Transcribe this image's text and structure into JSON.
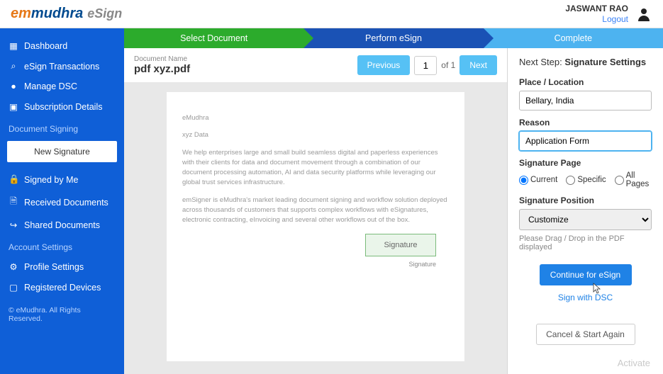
{
  "header": {
    "logo_em": "em",
    "logo_mudhra": "mudhra",
    "logo_esign": "eSign",
    "username": "JASWANT RAO",
    "logout": "Logout"
  },
  "sidebar": {
    "main": [
      {
        "icon": "▦",
        "label": "Dashboard"
      },
      {
        "icon": "⌕",
        "label": "eSign Transactions"
      },
      {
        "icon": "●",
        "label": "Manage DSC"
      },
      {
        "icon": "▣",
        "label": "Subscription Details"
      }
    ],
    "doc_section_title": "Document Signing",
    "new_signature": "New Signature",
    "doc_items": [
      {
        "icon": "🔒",
        "label": "Signed by Me"
      },
      {
        "icon": "🗎",
        "label": "Received Documents"
      },
      {
        "icon": "↪",
        "label": "Shared Documents"
      }
    ],
    "acct_section_title": "Account Settings",
    "acct_items": [
      {
        "icon": "⚙",
        "label": "Profile Settings"
      },
      {
        "icon": "▢",
        "label": "Registered Devices"
      }
    ],
    "copyright": "© eMudhra. All Rights Reserved."
  },
  "progress": {
    "step1": "Select Document",
    "step2": "Perform eSign",
    "step3": "Complete"
  },
  "doc": {
    "label": "Document Name",
    "filename": "pdf xyz.pdf",
    "prev": "Previous",
    "page_value": "1",
    "of_total": "of 1",
    "next": "Next",
    "content": {
      "title": "eMudhra",
      "subtitle": "xyz Data",
      "para1": "We help enterprises large and small build seamless digital and paperless experiences with their clients for data and document movement through a combination of our document processing automation, AI and data security platforms while leveraging our global trust services infrastructure.",
      "para2": "emSigner is eMudhra's market leading document signing and workflow solution deployed across thousands of customers that supports complex workflows with eSignatures, electronic contracting, eInvoicing and several other workflows out of the box."
    },
    "sig_placeholder": "Signature",
    "sig_label": "Signature"
  },
  "panel": {
    "next_step_pre": "Next Step: ",
    "next_step_bold": "Signature Settings",
    "place_label": "Place / Location",
    "place_value": "Bellary, India",
    "reason_label": "Reason",
    "reason_value": "Application Form",
    "sig_page_label": "Signature Page",
    "radio_current": "Current",
    "radio_specific": "Specific",
    "radio_all": "All Pages",
    "sig_pos_label": "Signature Position",
    "sig_pos_value": "Customize",
    "hint": "Please Drag / Drop in the PDF displayed",
    "continue": "Continue for eSign",
    "sign_dsc": "Sign with DSC",
    "cancel": "Cancel & Start Again"
  },
  "watermark": {
    "line1": "Activate"
  }
}
